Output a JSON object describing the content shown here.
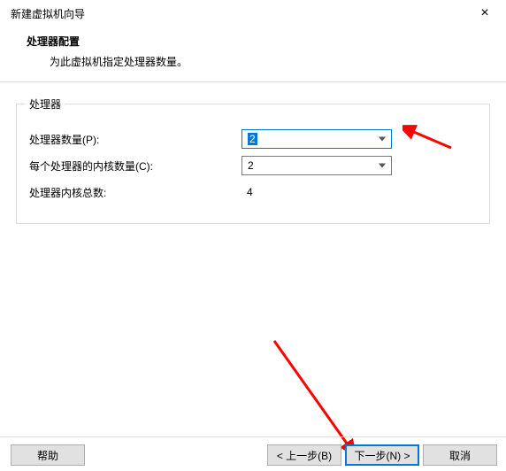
{
  "window": {
    "title": "新建虚拟机向导",
    "close_icon": "×"
  },
  "header": {
    "heading": "处理器配置",
    "subheading": "为此虚拟机指定处理器数量。"
  },
  "group": {
    "legend": "处理器",
    "rows": {
      "processors": {
        "label": "处理器数量(P):",
        "value": "2"
      },
      "cores": {
        "label": "每个处理器的内核数量(C):",
        "value": "2"
      },
      "total": {
        "label": "处理器内核总数:",
        "value": "4"
      }
    }
  },
  "footer": {
    "help": "帮助",
    "back": "< 上一步(B)",
    "next": "下一步(N) >",
    "cancel": "取消"
  }
}
